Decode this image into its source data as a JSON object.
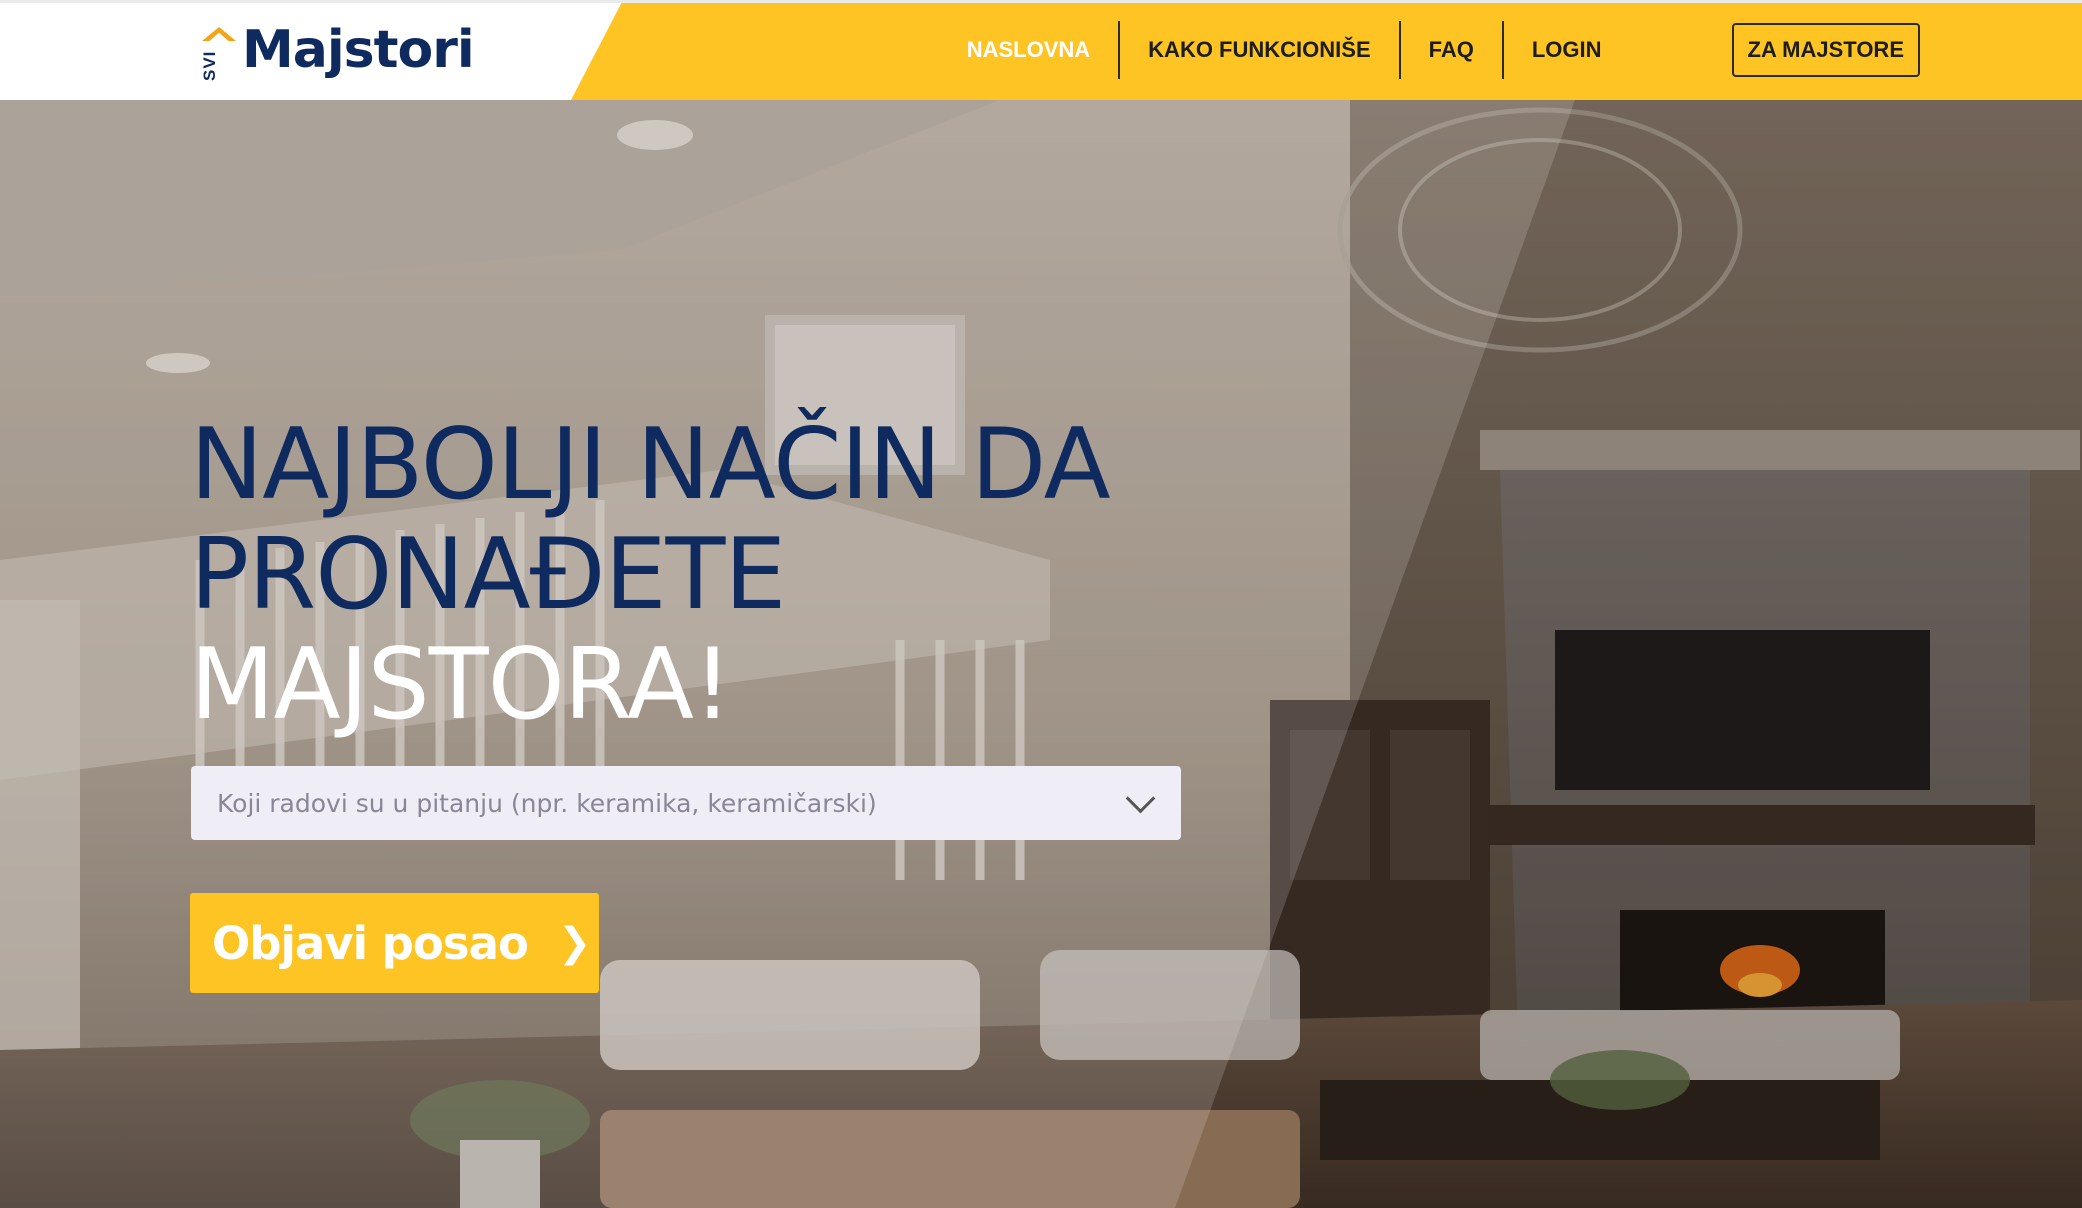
{
  "header": {
    "logo_small": "SVI",
    "logo_text": "Majstori",
    "nav": [
      {
        "label": "NASLOVNA",
        "active": true
      },
      {
        "label": "KAKO FUNKCIONIŠE",
        "active": false
      },
      {
        "label": "FAQ",
        "active": false
      },
      {
        "label": "LOGIN",
        "active": false
      }
    ],
    "cta_label": "ZA MAJSTORE"
  },
  "hero": {
    "title_line1": "NAJBOLJI NAČIN DA",
    "title_line2": "PRONAĐETE",
    "title_line3": "MAJSTORA!",
    "search": {
      "placeholder": "Koji radovi su u pitanju (npr. keramika, keramičarski)"
    },
    "button_label": "Objavi posao",
    "button_icon": "chevron-right-icon"
  },
  "colors": {
    "brand_yellow": "#fdc424",
    "brand_navy": "#0e2a5e",
    "logo_orange": "#f2a516"
  }
}
